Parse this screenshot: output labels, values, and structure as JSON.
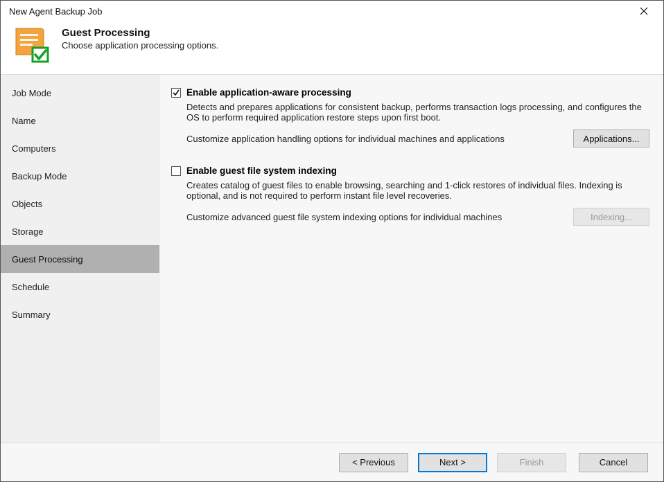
{
  "window": {
    "title": "New Agent Backup Job"
  },
  "header": {
    "title": "Guest Processing",
    "subtitle": "Choose application processing options."
  },
  "sidebar": {
    "steps": [
      {
        "label": "Job Mode",
        "active": false
      },
      {
        "label": "Name",
        "active": false
      },
      {
        "label": "Computers",
        "active": false
      },
      {
        "label": "Backup Mode",
        "active": false
      },
      {
        "label": "Objects",
        "active": false
      },
      {
        "label": "Storage",
        "active": false
      },
      {
        "label": "Guest Processing",
        "active": true
      },
      {
        "label": "Schedule",
        "active": false
      },
      {
        "label": "Summary",
        "active": false
      }
    ]
  },
  "content": {
    "option1": {
      "checked": true,
      "label": "Enable application-aware processing",
      "desc": "Detects and prepares applications for consistent backup, performs transaction logs processing, and configures the OS to perform required application restore steps upon first boot.",
      "customize_text": "Customize application handling options for individual machines and applications",
      "button": "Applications..."
    },
    "option2": {
      "checked": false,
      "label": "Enable guest file system indexing",
      "desc": "Creates catalog of guest files to enable browsing, searching and 1-click restores of individual files. Indexing is optional, and is not required to perform instant file level recoveries.",
      "customize_text": "Customize advanced guest file system indexing options for individual machines",
      "button": "Indexing..."
    }
  },
  "footer": {
    "previous": "< Previous",
    "next": "Next >",
    "finish": "Finish",
    "cancel": "Cancel"
  }
}
